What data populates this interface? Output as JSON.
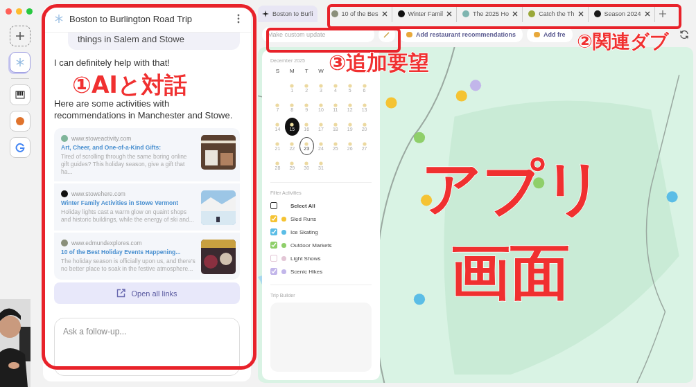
{
  "rail": {
    "items": [
      {
        "kind": "new",
        "selected": false
      },
      {
        "kind": "trip",
        "selected": true
      },
      {
        "kind": "piano",
        "selected": false
      },
      {
        "kind": "ball",
        "selected": false
      },
      {
        "kind": "google",
        "selected": false
      }
    ]
  },
  "chat": {
    "title": "Boston to Burlington Road Trip",
    "user_message": "things in Salem and Stowe",
    "reply": [
      "I can definitely help with that!",
      "Here are some activities with recommendations in Manchester and Stowe."
    ],
    "links": [
      {
        "domain": "www.stoweactivity.com",
        "color": "#7fb59a",
        "title": "Art, Cheer, and One-of-a-Kind Gifts:",
        "snippet": "Tired of scrolling through the same boring online gift guides? This holiday season, give a gift that ha..."
      },
      {
        "domain": "www.stowehere.com",
        "color": "#111111",
        "title": "Winter Family Activities in Stowe Vermont",
        "snippet": "Holiday lights cast a warm glow on quaint shops and historic buildings, while the energy of ski and..."
      },
      {
        "domain": "www.edmundexplores.com",
        "color": "#8a8f7a",
        "title": "10 of the Best Holiday Events Happening...",
        "snippet": "The holiday season is officially upon us, and there's no better place to soak in the festive atmosphere..."
      }
    ],
    "open_all": "Open all links",
    "followup": {
      "placeholder": "Ask a follow-up..."
    }
  },
  "tabs": [
    {
      "label": "Boston to Burli",
      "selected": true
    },
    {
      "label": "10 of the Bes",
      "selected": false,
      "color": "#8a8f7a"
    },
    {
      "label": "Winter Famil",
      "selected": false,
      "color": "#111111"
    },
    {
      "label": "The 2025 Ho",
      "selected": false,
      "color": "#7fb5b0"
    },
    {
      "label": "Catch the Th",
      "selected": false,
      "color": "#9aa83a"
    },
    {
      "label": "Season 2024",
      "selected": false,
      "color": "#1a1a1a"
    }
  ],
  "toolbar": {
    "custom_update": {
      "placeholder": "Make custom update"
    },
    "chips": [
      "Add restaurant recommendations",
      "Add fre"
    ]
  },
  "calendar": {
    "month": "December 2025",
    "weekdays": [
      "S",
      "M",
      "T",
      "W"
    ],
    "weeks": [
      [
        {
          "day": "1",
          "selected": false,
          "today": false
        },
        {
          "day": "2",
          "selected": false,
          "today": false
        },
        {
          "day": "3",
          "selected": false,
          "today": false
        },
        {
          "day": "4",
          "selected": false,
          "today": false
        },
        {
          "day": "5",
          "selected": false,
          "today": false
        },
        {
          "day": "6",
          "selected": false,
          "today": false
        }
      ],
      [
        {
          "day": "7",
          "selected": false,
          "today": false
        },
        {
          "day": "8",
          "selected": false,
          "today": false
        },
        {
          "day": "9",
          "selected": false,
          "today": false
        },
        {
          "day": "10",
          "selected": false,
          "today": false
        },
        {
          "day": "11",
          "selected": false,
          "today": false
        },
        {
          "day": "12",
          "selected": false,
          "today": false
        },
        {
          "day": "13",
          "selected": false,
          "today": false
        }
      ],
      [
        {
          "day": "14",
          "selected": false,
          "today": false
        },
        {
          "day": "15",
          "selected": true,
          "today": false
        },
        {
          "day": "16",
          "selected": false,
          "today": false
        },
        {
          "day": "17",
          "selected": false,
          "today": false
        },
        {
          "day": "18",
          "selected": false,
          "today": false
        },
        {
          "day": "19",
          "selected": false,
          "today": false
        },
        {
          "day": "20",
          "selected": false,
          "today": false
        }
      ],
      [
        {
          "day": "21",
          "selected": false,
          "today": false
        },
        {
          "day": "22",
          "selected": false,
          "today": false
        },
        {
          "day": "23",
          "selected": false,
          "today": true
        },
        {
          "day": "24",
          "selected": false,
          "today": false
        },
        {
          "day": "25",
          "selected": false,
          "today": false
        },
        {
          "day": "26",
          "selected": false,
          "today": false
        },
        {
          "day": "27",
          "selected": false,
          "today": false
        }
      ],
      [
        {
          "day": "28",
          "selected": false,
          "today": false
        },
        {
          "day": "29",
          "selected": false,
          "today": false
        },
        {
          "day": "30",
          "selected": false,
          "today": false
        },
        {
          "day": "31",
          "selected": false,
          "today": false
        }
      ]
    ]
  },
  "filters": {
    "title": "Filter Activities",
    "items": [
      {
        "label": "Select All",
        "checked": false,
        "color": "#333333"
      },
      {
        "label": "Sled Runs",
        "checked": true,
        "color": "#f5c333"
      },
      {
        "label": "Ice Skating",
        "checked": true,
        "color": "#5bbde6"
      },
      {
        "label": "Outdoor Markets",
        "checked": true,
        "color": "#8fcf6a"
      },
      {
        "label": "Light Shows",
        "checked": false,
        "color": "#e3c6d6"
      },
      {
        "label": "Scenic Hikes",
        "checked": true,
        "color": "#c2b6ea"
      }
    ]
  },
  "trip_builder": {
    "title": "Trip Builder"
  },
  "annotations": [
    "①AIと対話",
    "②関連ダブ",
    "③追加要望",
    "アプリ",
    "画面"
  ]
}
